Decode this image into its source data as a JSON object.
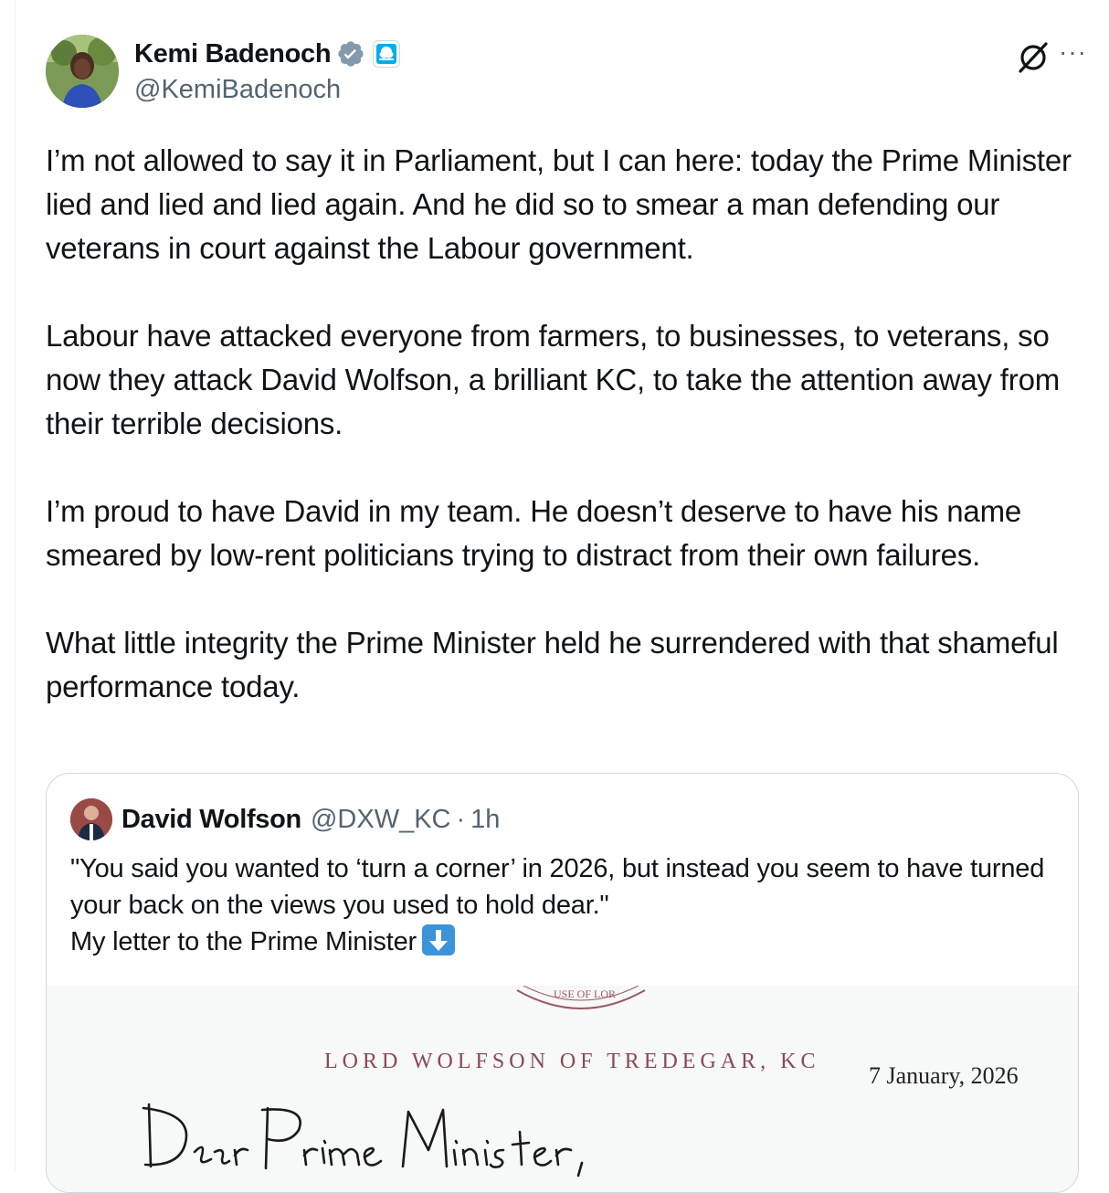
{
  "tweet": {
    "author": {
      "display_name": "Kemi Badenoch",
      "handle": "@KemiBadenoch",
      "verified_icon": "verified-badge-icon",
      "affiliate_icon": "conservative-party-tree-icon"
    },
    "actions": {
      "grok_icon": "grok-icon",
      "more_icon": "more-options-icon",
      "more_label": "···"
    },
    "body": {
      "p1": "I’m not allowed to say it in Parliament, but I can here: today the Prime Minister lied and lied and lied again. And he did so to smear a man defending our veterans in court against the Labour government.",
      "p2": "Labour have attacked everyone from farmers, to businesses, to veterans, so now they attack David Wolfson, a brilliant KC, to take the attention away from their terrible decisions.",
      "p3": "I’m proud to have David in my team. He doesn’t deserve to have his name smeared by low-rent politicians trying to distract from their own failures.",
      "p4": "What little integrity the Prime Minister held he surrendered with that shameful performance today."
    }
  },
  "quote": {
    "author": {
      "display_name": "David Wolfson",
      "handle": "@DXW_KC",
      "separator": "·",
      "time": "1h"
    },
    "text": {
      "line1": "\"You said you wanted to ‘turn a corner’ in 2026, but instead you seem to have turned your back on the views you used to hold dear.\"",
      "line2": "My letter to the Prime Minister",
      "emoji": "down-arrow-emoji-icon"
    },
    "letter_image": {
      "seal_text": "USE OF LOR",
      "letterhead": "LORD WOLFSON OF TREDEGAR, KC",
      "date": "7 January, 2026",
      "salutation": "Dear Prime Minister,"
    }
  },
  "colors": {
    "text": "#0f1419",
    "secondary": "#536471",
    "border": "#cfd9de",
    "verified_blue": "#1d9bf0",
    "letterhead": "#8a4a52"
  }
}
